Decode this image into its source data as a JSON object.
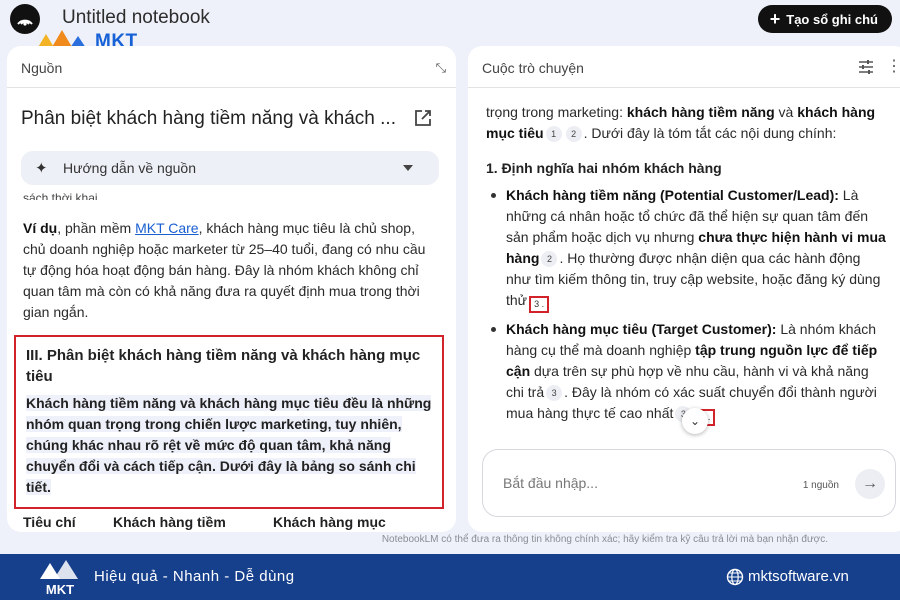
{
  "app": {
    "notebook_title": "Untitled notebook",
    "create_button": "Tạo sổ ghi chú",
    "watermark_text": "MKT"
  },
  "sources_panel": {
    "title": "Nguồn",
    "source_title": "Phân biệt khách hàng tiềm năng và khách ...",
    "guide_label": "Hướng dẫn về nguồn",
    "cut_line": "sách thời khai.",
    "para_bold": "Ví dụ",
    "para_pre_link": ", phần mềm ",
    "para_link": "MKT Care",
    "para_post_link": ", khách hàng mục tiêu là chủ shop, chủ doanh nghiệp hoặc marketer từ 25–40 tuổi, đang có nhu cầu tự động hóa hoạt động bán hàng. Đây là nhóm khách không chỉ quan tâm mà còn có khả năng đưa ra quyết định mua trong thời gian ngắn.",
    "section_heading": "III. Phân biệt khách hàng tiềm năng và khách hàng mục tiêu",
    "section_body": "Khách hàng tiềm năng và khách hàng mục tiêu đều là những nhóm quan trọng trong chiến lược marketing, tuy nhiên, chúng khác nhau rõ rệt về mức độ quan tâm, khả năng chuyển đổi và cách tiếp cận. Dưới đây là bảng so sánh chi tiết.",
    "table_headers": [
      "Tiêu chí",
      "Khách hàng tiềm",
      "Khách hàng mục"
    ]
  },
  "chat_panel": {
    "title": "Cuộc trò chuyện",
    "intro_1": "trọng trong marketing: ",
    "intro_b1": "khách hàng tiềm năng",
    "intro_2": " và ",
    "intro_b2": "khách hàng mục tiêu",
    "intro_3": ". Dưới đây là tóm tắt các nội dung chính:",
    "section_heading": "1. Định nghĩa hai nhóm khách hàng",
    "b1_title": "Khách hàng tiềm năng (Potential Customer/Lead):",
    "b1_t1": " Là những cá nhân hoặc tổ chức đã thể hiện sự quan tâm đến sản phẩm hoặc dịch vụ nhưng ",
    "b1_b": "chưa thực hiện hành vi mua hàng",
    "b1_t2": ". Họ thường được nhận diện qua các hành động như tìm kiếm thông tin, truy cập website, hoặc đăng ký dùng thử",
    "b2_title": "Khách hàng mục tiêu (Target Customer):",
    "b2_t1": " Là nhóm khách hàng cụ thể mà doanh nghiệp ",
    "b2_b": "tập trung nguồn lực để tiếp cận",
    "b2_t2": " dựa trên sự phù hợp về nhu cầu, hành vi và khả năng chi trả",
    "b2_t3": ". Đây là nhóm có xác suất chuyển đổi thành người mua hàng thực tế cao nhất",
    "cites": [
      "1",
      "2",
      "2",
      "3",
      "3",
      "3",
      "4"
    ],
    "input_placeholder": "Bắt đầu nhập...",
    "source_count": "1 nguồn"
  },
  "disclaimer": "NotebookLM có thể đưa ra thông tin không chính xác; hãy kiểm tra kỹ câu trả lời mà bạn nhận được.",
  "footer": {
    "tagline": "Hiệu quả - Nhanh - Dễ dùng",
    "website": "mktsoftware.vn",
    "logo_text": "MKT"
  },
  "colors": {
    "highlight_border": "#d2232a",
    "banner": "#163f8c",
    "link": "#1a5fd0"
  }
}
